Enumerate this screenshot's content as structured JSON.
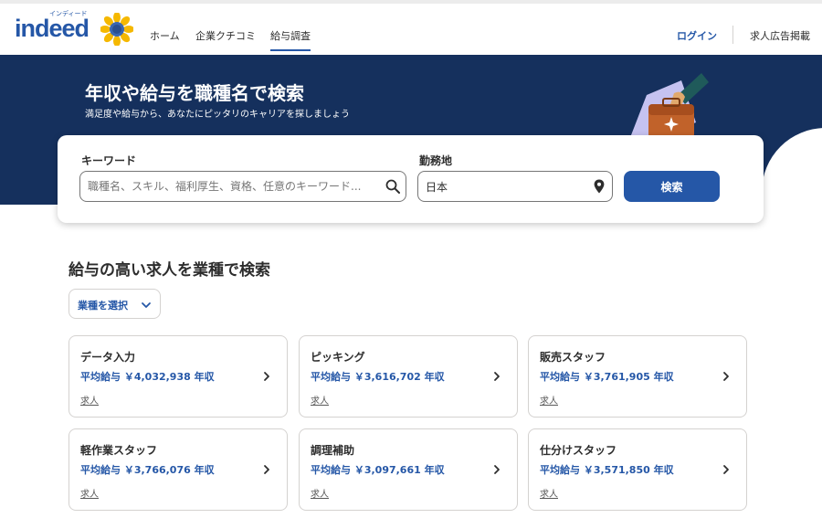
{
  "header": {
    "logo_text": "indeed",
    "logo_kana": "インディード",
    "nav": [
      {
        "label": "ホーム"
      },
      {
        "label": "企業クチコミ"
      },
      {
        "label": "給与調査"
      }
    ],
    "active_nav": "給与調査",
    "login_label": "ログイン",
    "employer_label": "求人広告掲載"
  },
  "hero": {
    "title": "年収や給与を職種名で検索",
    "subtitle": "満足度や給与から、あなたにピッタリのキャリアを探しましょう"
  },
  "search": {
    "keyword_label": "キーワード",
    "keyword_placeholder": "職種名、スキル、福利厚生、資格、任意のキーワード...",
    "location_label": "勤務地",
    "location_value": "日本",
    "button_label": "検索"
  },
  "section": {
    "title": "給与の高い求人を業種で検索",
    "category_select_label": "業種を選択"
  },
  "jobs": [
    {
      "title": "データ入力",
      "salary": "平均給与 ￥4,032,938 年収",
      "link": "求人"
    },
    {
      "title": "ピッキング",
      "salary": "平均給与 ￥3,616,702 年収",
      "link": "求人"
    },
    {
      "title": "販売スタッフ",
      "salary": "平均給与 ￥3,761,905 年収",
      "link": "求人"
    },
    {
      "title": "軽作業スタッフ",
      "salary": "平均給与 ￥3,766,076 年収",
      "link": "求人"
    },
    {
      "title": "調理補助",
      "salary": "平均給与 ￥3,097,661 年収",
      "link": "求人"
    },
    {
      "title": "仕分けスタッフ",
      "salary": "平均給与 ￥3,571,850 年収",
      "link": "求人"
    }
  ],
  "colors": {
    "brand_blue": "#2557a7",
    "hero_navy": "#15305d",
    "text": "#2d2d2d",
    "border": "#d4d2d0"
  },
  "icons": [
    "sunflower-icon",
    "briefcase-icon",
    "search-icon",
    "location-pin-icon",
    "chevron-down-icon",
    "chevron-right-icon"
  ]
}
